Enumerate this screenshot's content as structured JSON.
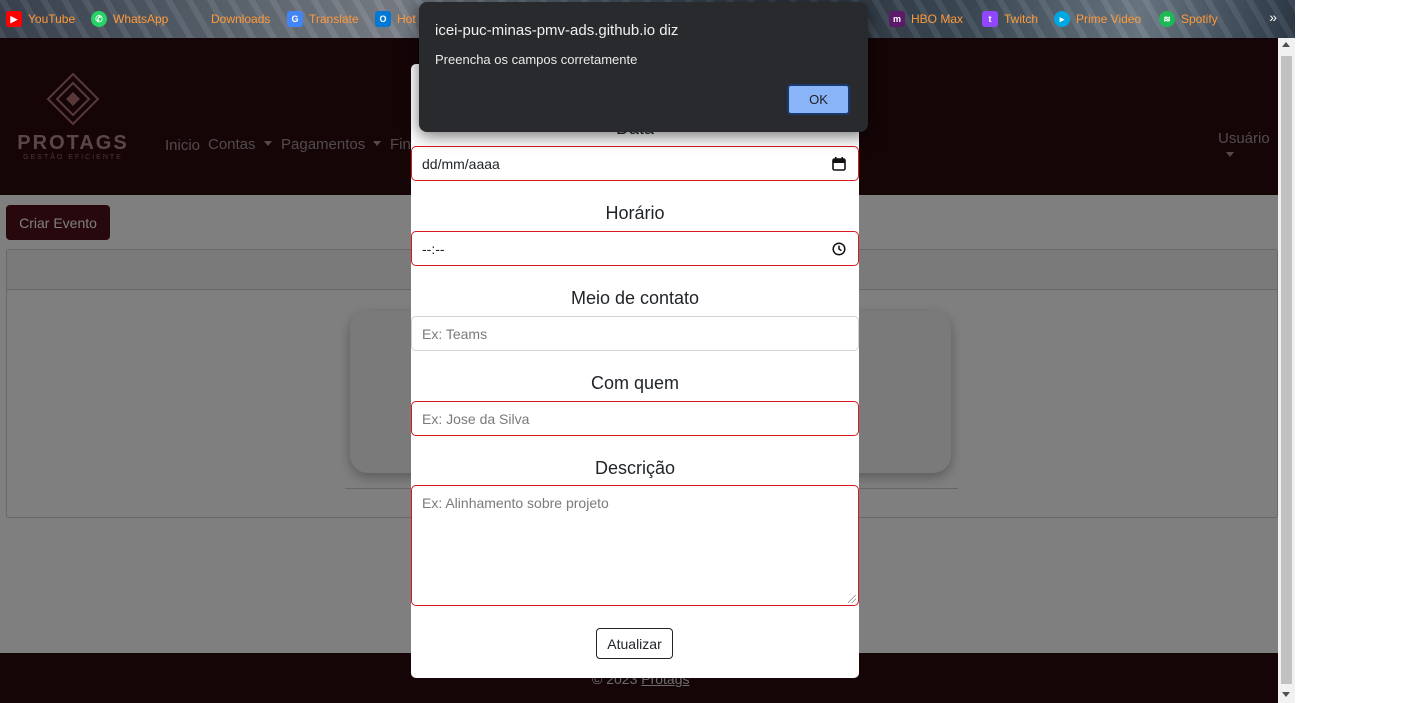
{
  "bookmarks": [
    {
      "label": "YouTube",
      "icon": "youtube-icon",
      "color": "#ff0000"
    },
    {
      "label": "WhatsApp",
      "icon": "whatsapp-icon",
      "color": "#25d366"
    },
    {
      "label": "Downloads",
      "icon": "download-icon",
      "color": "#7a6a4a"
    },
    {
      "label": "Translate",
      "icon": "google-translate-icon",
      "color": "#4285f4"
    },
    {
      "label": "Hot",
      "icon": "outlook-icon",
      "color": "#0078d4"
    },
    {
      "label": "HBO Max",
      "icon": "hbo-max-icon",
      "color": "#5b1a6a"
    },
    {
      "label": "Twitch",
      "icon": "twitch-icon",
      "color": "#9146ff"
    },
    {
      "label": "Prime Video",
      "icon": "prime-video-icon",
      "color": "#00a8e1"
    },
    {
      "label": "Spotify",
      "icon": "spotify-icon",
      "color": "#1db954"
    }
  ],
  "bookmarks_more": "»",
  "site": {
    "brand": "PROTAGS",
    "tagline": "GESTÃO EFICIENTE",
    "nav": {
      "inicio": "Inicio",
      "contas": "Contas",
      "pagamentos": "Pagamentos",
      "fin": "Fin",
      "usuario": "Usuário"
    },
    "create_event": "Criar Evento",
    "footer": {
      "copyright": "© 2023",
      "link": "Protags"
    }
  },
  "modal": {
    "partial_label": "Data",
    "date_value": "dd/mm/aaaa",
    "time_label": "Horário",
    "time_value": "--:--",
    "contact_label": "Meio de contato",
    "contact_placeholder": "Ex: Teams",
    "with_label": "Com quem",
    "with_placeholder": "Ex: Jose da Silva",
    "desc_label": "Descrição",
    "desc_placeholder": "Ex: Alinhamento sobre projeto",
    "submit": "Atualizar"
  },
  "alert": {
    "title": "icei-puc-minas-pmv-ads.github.io diz",
    "message": "Preencha os campos corretamente",
    "ok": "OK"
  },
  "colors": {
    "brand_dark": "#2b0a0f",
    "button_primary": "#4e1019",
    "invalid_border": "#d71920",
    "dialog_bg": "#282a2e",
    "dialog_button": "#8ab4f8"
  }
}
